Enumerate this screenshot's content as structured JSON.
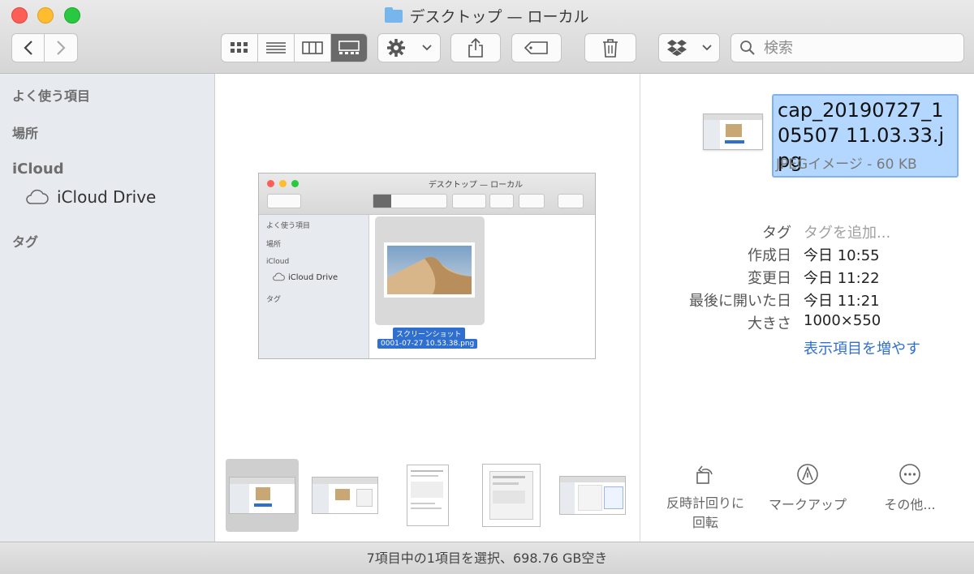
{
  "window": {
    "title": "デスクトップ — ローカル"
  },
  "search": {
    "placeholder": "検索"
  },
  "sidebar": {
    "sections": [
      {
        "label": "よく使う項目"
      },
      {
        "label": "場所"
      },
      {
        "label": "iCloud"
      },
      {
        "label": "タグ"
      }
    ],
    "items": [
      {
        "label": "iCloud Drive"
      }
    ]
  },
  "preview": {
    "window_title": "デスクトップ — ローカル",
    "sidebar_labels": [
      "よく使う項目",
      "場所",
      "iCloud",
      "iCloud Drive",
      "タグ"
    ],
    "file_label_line1": "スクリーンショット",
    "file_label_line2": "0001-07-27 10.53.38.png"
  },
  "inspector": {
    "filename": "cap_20190727_105507 11.03.33.jpg",
    "filetype": "JPEGイメージ - 60 KB",
    "meta": [
      {
        "key": "タグ",
        "value": "タグを追加..."
      },
      {
        "key": "作成日",
        "value": "今日 10:55"
      },
      {
        "key": "変更日",
        "value": "今日 11:22"
      },
      {
        "key": "最後に開いた日",
        "value": "今日 11:21"
      },
      {
        "key": "大きさ",
        "value": "1000×550"
      }
    ],
    "more_link": "表示項目を増やす",
    "actions": [
      {
        "label": "反時計回りに回転"
      },
      {
        "label": "マークアップ"
      },
      {
        "label": "その他..."
      }
    ]
  },
  "status": {
    "text": "7項目中の1項目を選択、698.76 GB空き"
  },
  "colors": {
    "accent": "#2f6fd0",
    "selection": "#b3d7ff",
    "folder": "#76b6ec"
  }
}
